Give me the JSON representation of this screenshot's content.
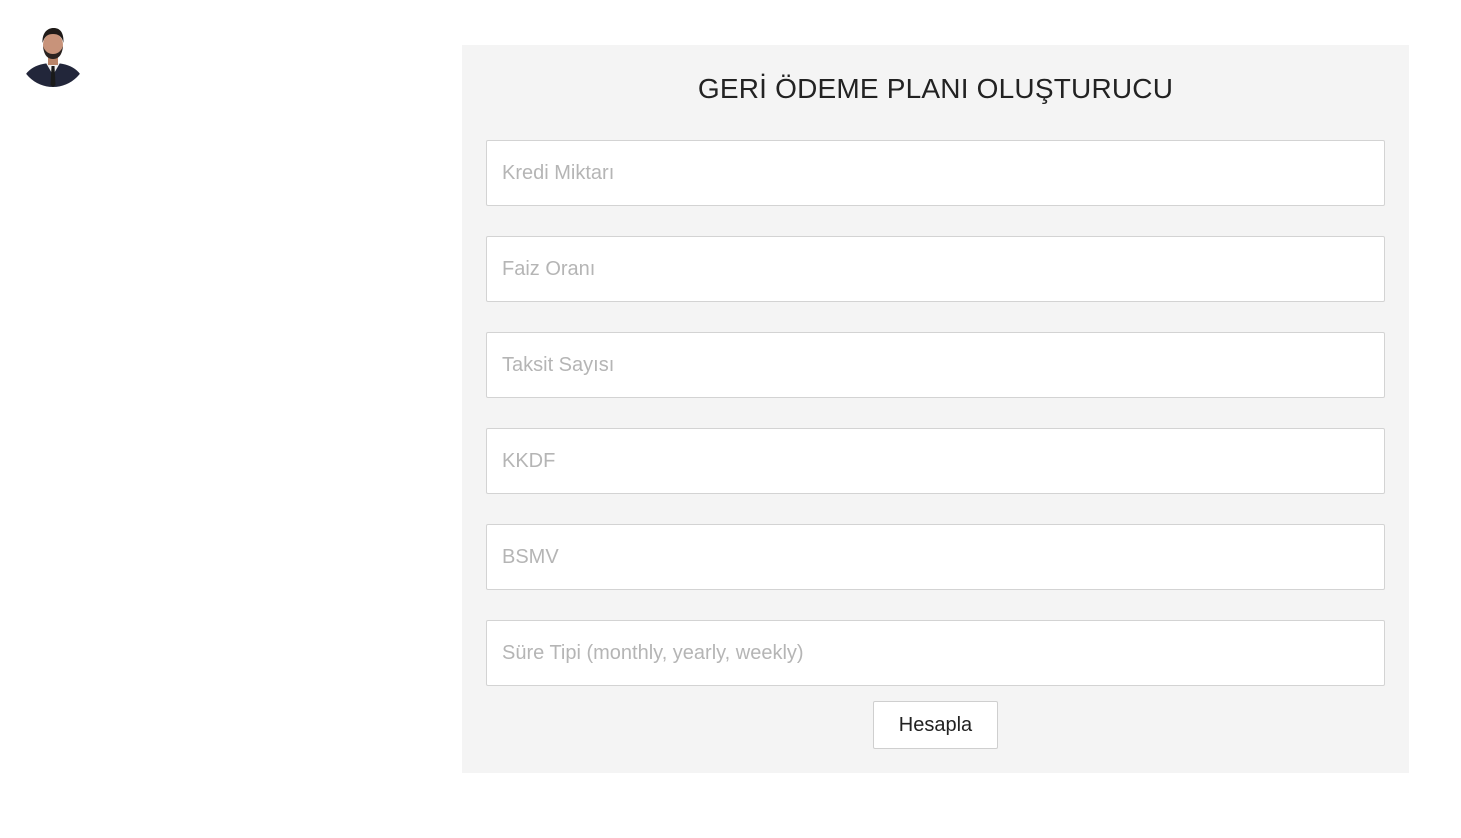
{
  "profile": {
    "avatar_icon": "profile-photo"
  },
  "form": {
    "title": "GERİ ÖDEME PLANI OLUŞTURUCU",
    "fields": [
      {
        "placeholder": "Kredi Miktarı",
        "value": ""
      },
      {
        "placeholder": "Faiz Oranı",
        "value": ""
      },
      {
        "placeholder": "Taksit Sayısı",
        "value": ""
      },
      {
        "placeholder": "KKDF",
        "value": ""
      },
      {
        "placeholder": "BSMV",
        "value": ""
      },
      {
        "placeholder": "Süre Tipi (monthly, yearly, weekly)",
        "value": ""
      }
    ],
    "submit_label": "Hesapla"
  },
  "colors": {
    "page_background": "#ffffff",
    "panel_background": "#f4f4f4",
    "input_border": "#d3d3d3",
    "placeholder_text": "#b5b5b5",
    "title_text": "#222222"
  }
}
